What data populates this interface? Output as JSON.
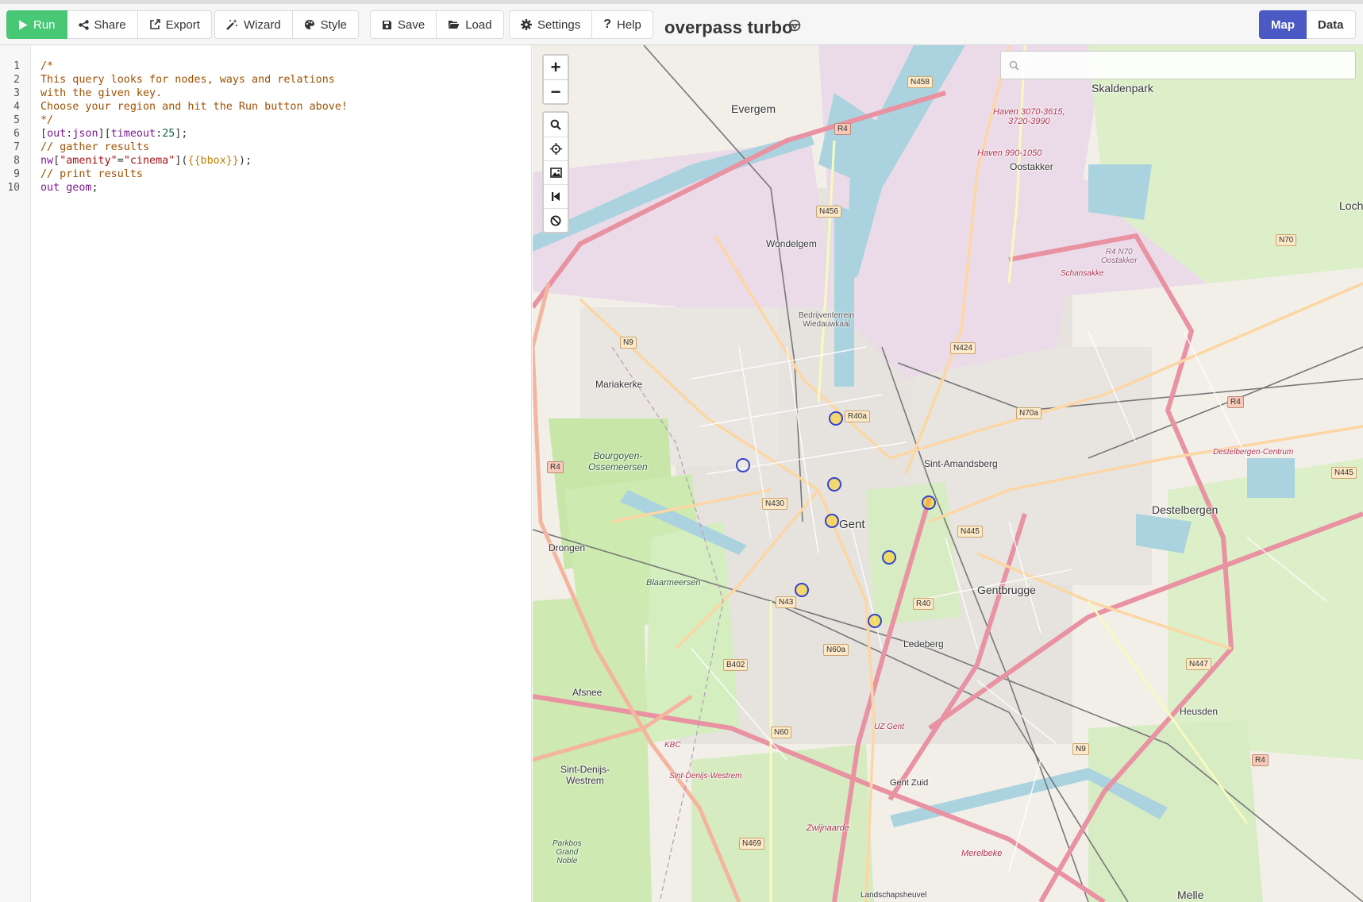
{
  "toolbar": {
    "run": "Run",
    "share": "Share",
    "export": "Export",
    "wizard": "Wizard",
    "style": "Style",
    "save": "Save",
    "load": "Load",
    "settings": "Settings",
    "help": "Help",
    "title": "overpass turbo",
    "map_tab": "Map",
    "data_tab": "Data",
    "active_tab": "Map"
  },
  "editor": {
    "line_numbers": [
      "1",
      "2",
      "3",
      "4",
      "5",
      "6",
      "7",
      "8",
      "9",
      "10"
    ],
    "lines": [
      "/*",
      "This query looks for nodes, ways and relations",
      "with the given key.",
      "Choose your region and hit the Run button above!",
      "*/",
      "[out:json][timeout:25];",
      "// gather results",
      "nw[\"amenity\"=\"cinema\"]({{bbox}});",
      "// print results",
      "out geom;"
    ]
  },
  "map": {
    "search_placeholder": "",
    "labels": {
      "evergem": "Evergem",
      "skaldenpark": "Skaldenpark",
      "oostakker": "Oostakker",
      "wondelgem": "Wondelgem",
      "mariakerke": "Mariakerke",
      "bourgoyen": "Bourgoyen-\nOssemeersen",
      "sint_amandsberg": "Sint-Amandsberg",
      "gent": "Gent",
      "drongen": "Drongen",
      "blaarmeersen": "Blaarmeersen",
      "destelbergen": "Destelbergen",
      "gentbrugge": "Gentbrugge",
      "ledeberg": "Ledeberg",
      "afsnee": "Afsnee",
      "heusden": "Heusden",
      "sint_denijs": "Sint-Denijs-\nWestrem",
      "gent_zuid": "Gent Zuid",
      "zwijnaarde": "Zwijnaarde",
      "melle": "Melle",
      "merelbeke": "Merelbeke",
      "loch": "Loch",
      "parkbos": "Parkbos\nGrand\nNoble",
      "landschapsheuvel": "Landschapsheuvel",
      "haven1": "Haven 3070-3615,\n3720-3990",
      "haven2": "Haven 990-1050",
      "r4_oostakker": "R4 N70\nOostakker",
      "schansakker": "Schansakke",
      "bedrijventerrein": "Bedrijventerrein\nWiedauwkaai",
      "destelbergen_centrum": "Destelbergen-Centrum",
      "uz_gent": "UZ Gent",
      "sint_denijs_westrem": "Sint-Denijs-Westrem",
      "kbc": "KBC"
    },
    "shields": {
      "n458": "N458",
      "r4a": "R4",
      "n456": "N456",
      "n70": "N70",
      "n9a": "N9",
      "n424": "N424",
      "r40a": "R40a",
      "n70a": "N70a",
      "r4b": "R4",
      "r4c": "R4",
      "n430": "N430",
      "n445": "N445",
      "n445b": "N445",
      "n43": "N43",
      "r40": "R40",
      "n60a": "N60a",
      "b402": "B402",
      "n447": "N447",
      "n60": "N60",
      "n9b": "N9",
      "r4d": "R4",
      "n469": "N469"
    },
    "cinemas_count": 9
  }
}
